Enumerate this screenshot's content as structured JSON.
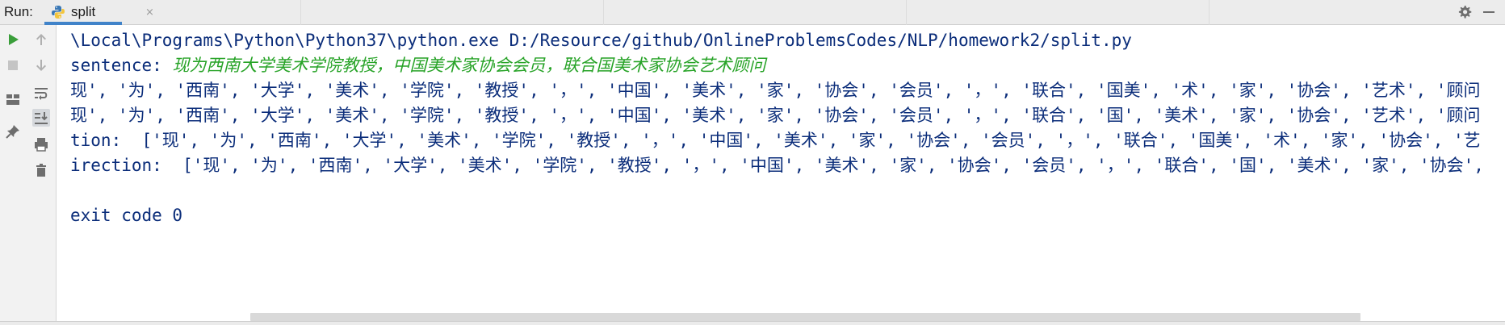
{
  "run_panel": {
    "label": "Run:",
    "tab": {
      "title": "split",
      "close_glyph": "×",
      "icon": "python-file-icon"
    },
    "right_icons": [
      "gear-icon",
      "minimize-icon"
    ]
  },
  "toolbar": {
    "left": [
      "run-icon",
      "stop-icon",
      "layout-icon",
      "pin-icon"
    ],
    "right": [
      "up-arrow-icon",
      "down-arrow-icon",
      "soft-wrap-icon",
      "scroll-to-end-icon",
      "print-icon",
      "trash-icon"
    ]
  },
  "console": {
    "lines": [
      {
        "text": "\\Local\\Programs\\Python\\Python37\\python.exe D:/Resource/github/OnlineProblemsCodes/NLP/homework2/split.py"
      },
      {
        "prefix": "sentence: ",
        "highlight": "现为西南大学美术学院教授，中国美术家协会会员，联合国美术家协会艺术顾问"
      },
      {
        "text": "现', '为', '西南', '大学', '美术', '学院', '教授', '，', '中国', '美术', '家', '协会', '会员', '，', '联合', '国美', '术', '家', '协会', '艺术', '顾问"
      },
      {
        "text": "现', '为', '西南', '大学', '美术', '学院', '教授', '，', '中国', '美术', '家', '协会', '会员', '，', '联合', '国', '美术', '家', '协会', '艺术', '顾问"
      },
      {
        "text": "tion:  ['现', '为', '西南', '大学', '美术', '学院', '教授', '，', '中国', '美术', '家', '协会', '会员', '，', '联合', '国美', '术', '家', '协会', '艺"
      },
      {
        "text": "irection:  ['现', '为', '西南', '大学', '美术', '学院', '教授', '，', '中国', '美术', '家', '协会', '会员', '，', '联合', '国', '美术', '家', '协会', "
      },
      {
        "text": ""
      },
      {
        "text": "exit code 0"
      }
    ]
  },
  "colors": {
    "console_text": "#0b2d7a",
    "highlight_text": "#27a327",
    "tab_underline": "#4083c9",
    "run_green": "#3a9e3a"
  }
}
